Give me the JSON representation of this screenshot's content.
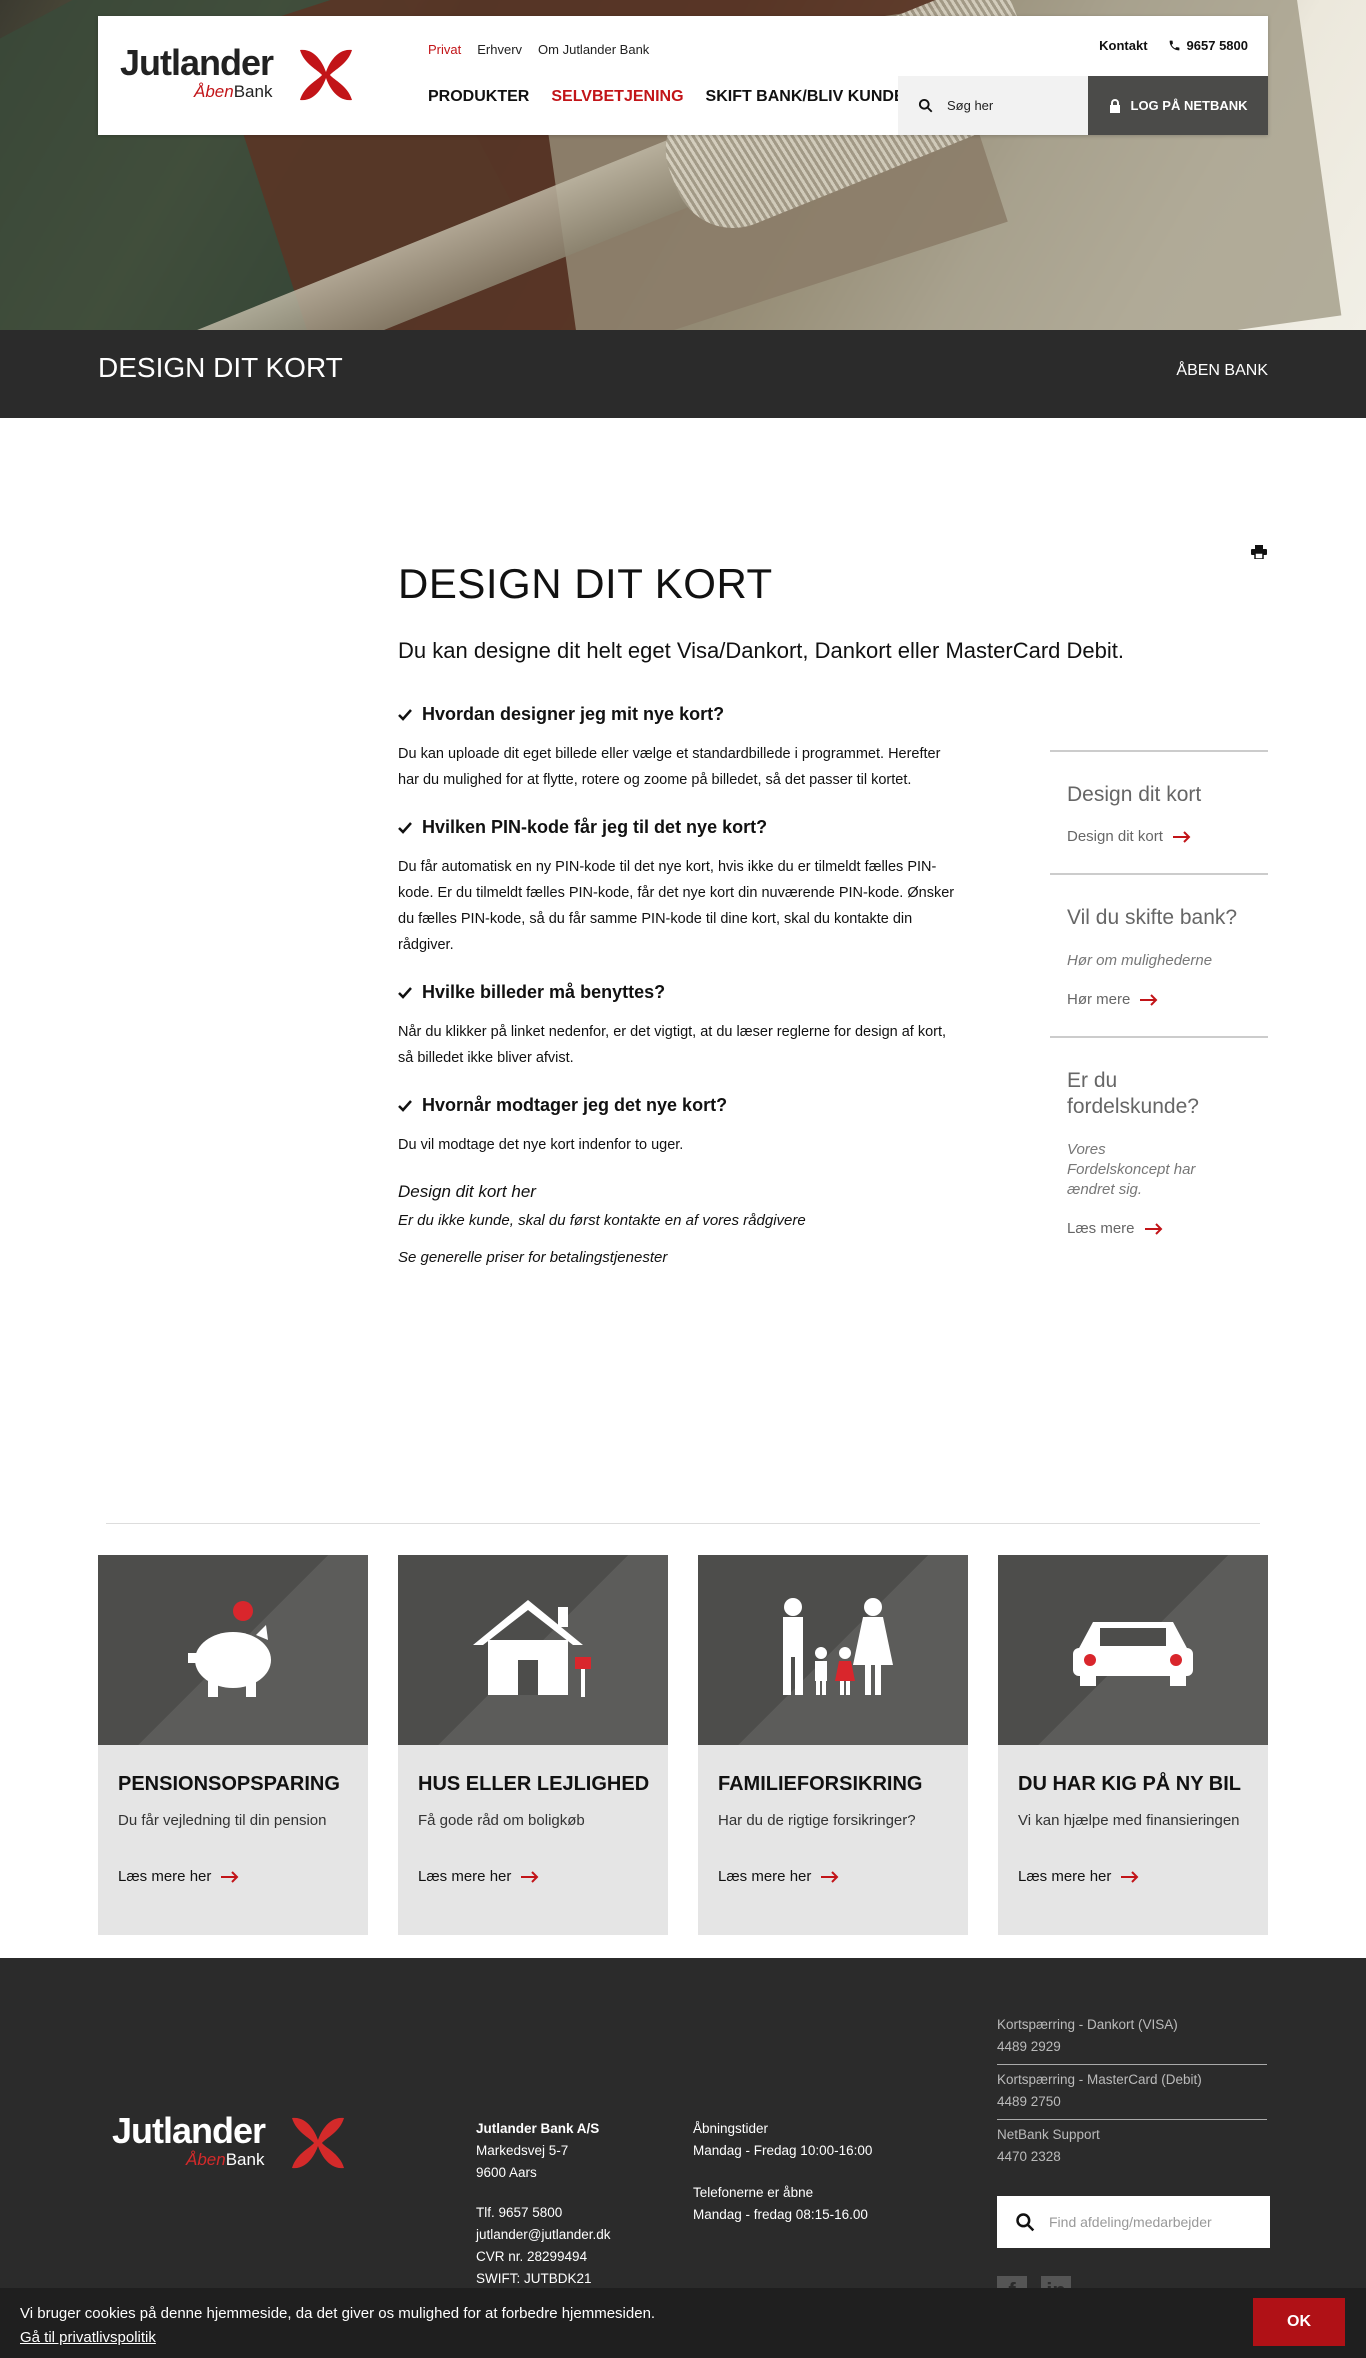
{
  "brand": {
    "logo_word": "Jutlander",
    "logo_sub_red": "Åben",
    "logo_sub": "Bank",
    "accent": "#c21418"
  },
  "header": {
    "toplinks": [
      "Privat",
      "Erhverv",
      "Om Jutlander Bank"
    ],
    "nav": [
      "PRODUKTER",
      "SELVBETJENING",
      "SKIFT BANK/BLIV KUNDE"
    ],
    "contact_label": "Kontakt",
    "phone": "9657 5800",
    "search_placeholder": "Søg her",
    "login_label": "LOG PÅ NETBANK"
  },
  "titlebar": {
    "title": "DESIGN DIT KORT",
    "breadcrumb": "ÅBEN BANK"
  },
  "main": {
    "title": "DESIGN DIT KORT",
    "lead": "Du kan designe dit helt eget Visa/Dankort, Dankort eller MasterCard Debit.",
    "faq": [
      {
        "q": "Hvordan designer jeg mit nye kort?",
        "a": "Du kan uploade dit eget billede eller vælge et standardbillede i programmet. Herefter har du mulighed for at flytte, rotere og zoome på billedet, så det passer til kortet."
      },
      {
        "q": "Hvilken PIN-kode får jeg til det nye kort?",
        "a": "Du får automatisk en ny PIN-kode til det nye kort, hvis ikke du er tilmeldt fælles PIN-kode. Er du tilmeldt fælles PIN-kode, får det nye kort din nuværende PIN-kode. Ønsker du fælles PIN-kode, så du får samme PIN-kode til dine kort, skal du kontakte din rådgiver."
      },
      {
        "q": "Hvilke billeder må benyttes?",
        "a": "Når du klikker på linket nedenfor, er det vigtigt, at du læser reglerne for design af kort, så billedet ikke bliver afvist."
      },
      {
        "q": "Hvornår modtager jeg det nye kort?",
        "a": "Du vil modtage det nye kort indenfor to uger."
      }
    ],
    "link_design": "Design dit kort her",
    "link_not_customer": "Er du ikke kunde, skal du først kontakte en af vores rådgivere",
    "link_prices": "Se generelle priser for betalingstjenester"
  },
  "aside": [
    {
      "title": "Design dit kort",
      "text": "",
      "link": "Design dit kort"
    },
    {
      "title": "Vil du skifte bank?",
      "text": "Hør om mulighederne",
      "link": "Hør mere"
    },
    {
      "title": "Er du fordelskunde?",
      "text": "Vores Fordelskoncept har ændret sig.",
      "link": "Læs mere"
    }
  ],
  "cards": [
    {
      "title": "PENSIONSOPSPARING",
      "desc": "Du får vejledning til din pension",
      "more": "Læs mere her",
      "icon": "piggy-bank-icon"
    },
    {
      "title": "HUS ELLER LEJLIGHED",
      "desc": "Få gode råd om boligkøb",
      "more": "Læs mere her",
      "icon": "house-icon"
    },
    {
      "title": "FAMILIEFORSIKRING",
      "desc": "Har du de rigtige forsikringer?",
      "more": "Læs mere her",
      "icon": "family-icon"
    },
    {
      "title": "DU HAR KIG PÅ NY BIL",
      "desc": "Vi kan hjælpe med finansieringen",
      "more": "Læs mere her",
      "icon": "car-icon"
    }
  ],
  "footer": {
    "company": "Jutlander Bank A/S",
    "address1": "Markedsvej 5-7",
    "address2": "9600 Aars",
    "phone": "Tlf. 9657 5800",
    "email": "jutlander@jutlander.dk",
    "cvr": "CVR nr. 28299494",
    "swift": "SWIFT: JUTBDK21",
    "hours_title": "Åbningstider",
    "hours": "Mandag - Fredag 10:00-16:00",
    "phones_title": "Telefonerne er åbne",
    "phones_hours": "Mandag - fredag 08:15-16.00",
    "blocks": [
      {
        "label": "Kortspærring - Dankort (VISA)",
        "value": "4489 2929"
      },
      {
        "label": "Kortspærring - MasterCard (Debit)",
        "value": "4489 2750"
      },
      {
        "label": "NetBank Support",
        "value": "4470 2328"
      }
    ],
    "search_placeholder": "Find afdeling/medarbejder",
    "social": [
      "f",
      "in"
    ]
  },
  "cookie": {
    "text": "Vi bruger cookies på denne hjemmeside, da det giver os mulighed for at forbedre hjemmesiden.",
    "link": "Gå til privatlivspolitik",
    "ok": "OK"
  }
}
